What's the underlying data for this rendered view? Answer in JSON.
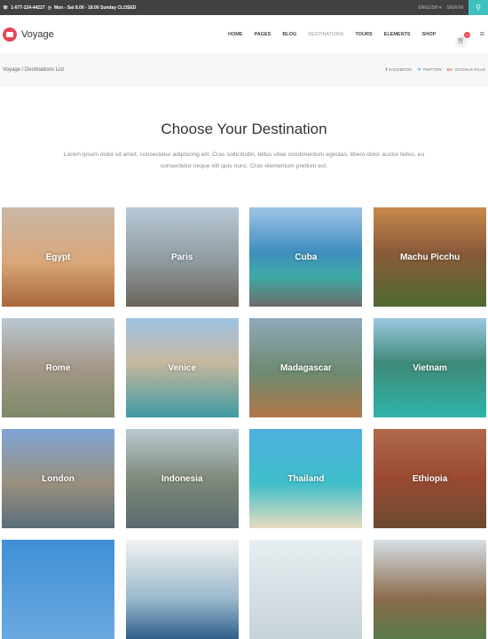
{
  "topbar": {
    "phone": "1-677-124-44227",
    "hours": "Mon - Sat 8.00 - 18.00 Sunday CLOSED",
    "language": "ENGLISH",
    "sign_in": "SIGN IN"
  },
  "header": {
    "logo": "Voyage",
    "nav": [
      "HOME",
      "PAGES",
      "BLOG",
      "DESTINATIONS",
      "TOURS",
      "ELEMENTS",
      "SHOP"
    ],
    "active": "DESTINATIONS",
    "cart_count": "0"
  },
  "breadcrumb": "Voyage / Destinations List",
  "social": [
    "FACEBOOK",
    "TWITTER",
    "GOOGLE PLUS"
  ],
  "main": {
    "title": "Choose Your Destination",
    "lead": "Lorem ipsum dolor sit amet, consectetur adipiscing elit. Cras sollicitudin, tellus vitae condimentum egestas, libero dolor auctor tellus, eu consectetur neque elit quis nunc. Cras elementum pretium est."
  },
  "destinations": [
    "Egypt",
    "Paris",
    "Cuba",
    "Machu Picchu",
    "Rome",
    "Venice",
    "Madagascar",
    "Vietnam",
    "London",
    "Indonesia",
    "Thailand",
    "Ethiopia"
  ]
}
